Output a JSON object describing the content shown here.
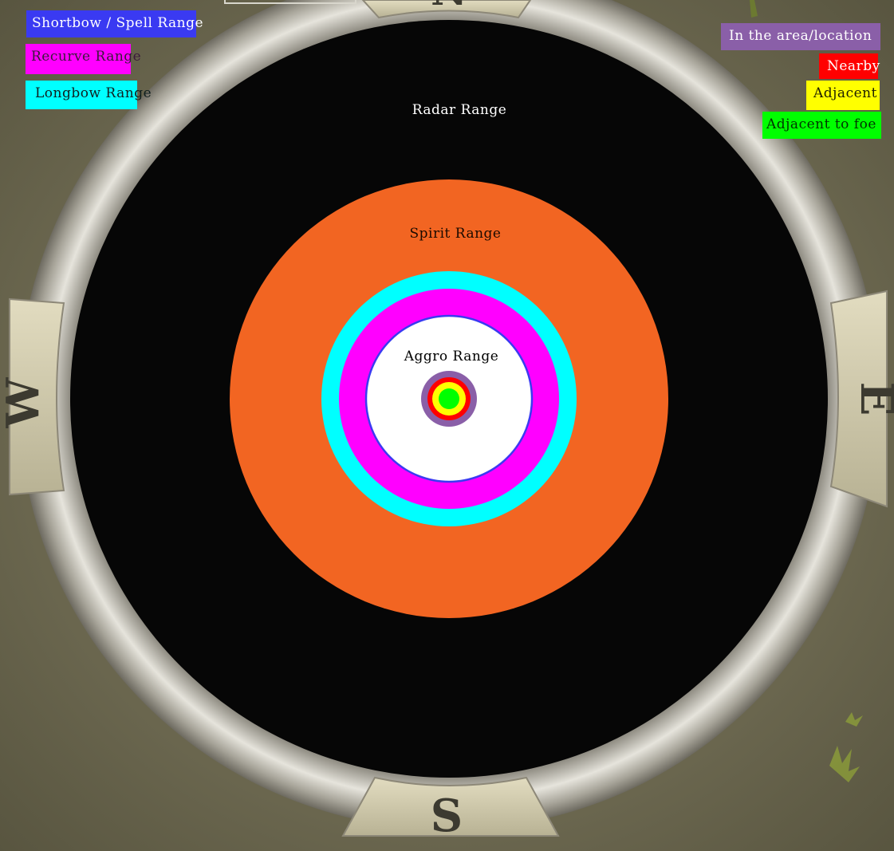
{
  "compass": {
    "directions": {
      "north": "N",
      "south": "S",
      "east": "E",
      "west": "W"
    },
    "bezel_color": "#b9b6ab",
    "ground_color": "#6e6a52"
  },
  "legend_left": [
    {
      "label": "Shortbow / Spell Range",
      "color": "#3a3af2",
      "text_color": "#ffffff"
    },
    {
      "label": "Recurve Range",
      "color": "#ff00ff",
      "text_color": "#3a1a3a"
    },
    {
      "label": "Longbow Range",
      "color": "#00ffff",
      "text_color": "#102020"
    }
  ],
  "legend_right": [
    {
      "label": "In the area/location",
      "color": "#8a5fa8",
      "text_color": "#ffffff"
    },
    {
      "label": "Nearby",
      "color": "#ff0000",
      "text_color": "#ffffff"
    },
    {
      "label": "Adjacent",
      "color": "#ffff00",
      "text_color": "#202000"
    },
    {
      "label": "Adjacent to foe",
      "color": "#00ff00",
      "text_color": "#003300"
    }
  ],
  "rings": {
    "radar": {
      "label": "Radar Range",
      "color": "#060606",
      "label_color": "#ffffff"
    },
    "spirit": {
      "label": "Spirit Range",
      "color": "#f26522",
      "label_color": "#1a0a00"
    },
    "longbow": {
      "color": "#00ffff"
    },
    "recurve": {
      "color": "#ff00ff"
    },
    "aggro": {
      "label": "Aggro Range",
      "color": "#ffffff",
      "border_color": "#3a3af2",
      "label_color": "#000000"
    },
    "area": {
      "color": "#8a5fa8"
    },
    "nearby": {
      "color": "#ff0000"
    },
    "adjacent": {
      "color": "#ffff00"
    },
    "adjacent_to_foe": {
      "color": "#00ff00"
    }
  }
}
